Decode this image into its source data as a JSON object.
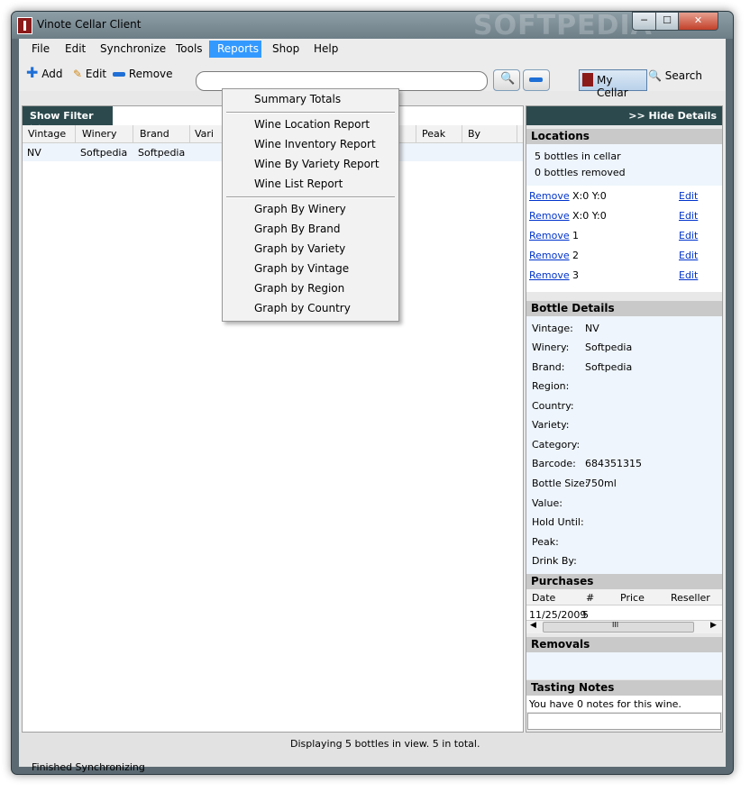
{
  "window": {
    "title": "Vinote Cellar Client",
    "watermark": "SOFTPEDIA"
  },
  "menu": {
    "file": "File",
    "edit": "Edit",
    "synchronize": "Synchronize",
    "tools": "Tools",
    "reports": "Reports",
    "shop": "Shop",
    "help": "Help"
  },
  "reports_menu": {
    "items": [
      "Summary Totals",
      "Wine Location Report",
      "Wine Inventory Report",
      "Wine By Variety Report",
      "Wine List Report",
      "Graph By Winery",
      "Graph By Brand",
      "Graph by Variety",
      "Graph by Vintage",
      "Graph by Region",
      "Graph by Country"
    ]
  },
  "toolbar": {
    "add": "Add",
    "edit": "Edit",
    "remove": "Remove",
    "my_cellar": "My Cellar",
    "search": "Search",
    "search_value": ""
  },
  "list": {
    "show_filter": "Show Filter >>",
    "columns": [
      "Vintage",
      "Winery",
      "Brand",
      "Vari",
      "old",
      "Peak",
      "By"
    ],
    "rows": [
      {
        "vintage": "NV",
        "winery": "Softpedia",
        "brand": "Softpedia"
      }
    ]
  },
  "details": {
    "hide_details": ">> Hide Details",
    "locations_title": "Locations",
    "in_cellar": "5 bottles in cellar",
    "removed": "0 bottles removed",
    "remove_label": "Remove",
    "edit_label": "Edit",
    "location_rows": [
      "X:0 Y:0",
      "X:0 Y:0",
      "1",
      "2",
      "3"
    ],
    "bottle_title": "Bottle Details",
    "fields": [
      {
        "label": "Vintage:",
        "value": "NV"
      },
      {
        "label": "Winery:",
        "value": "Softpedia"
      },
      {
        "label": "Brand:",
        "value": "Softpedia"
      },
      {
        "label": "Region:",
        "value": ""
      },
      {
        "label": "Country:",
        "value": ""
      },
      {
        "label": "Variety:",
        "value": ""
      },
      {
        "label": "Category:",
        "value": ""
      },
      {
        "label": "Barcode:",
        "value": "684351315"
      },
      {
        "label": "Bottle Size:",
        "value": "750ml"
      },
      {
        "label": "Value:",
        "value": ""
      },
      {
        "label": "Hold Until:",
        "value": ""
      },
      {
        "label": "Peak:",
        "value": ""
      },
      {
        "label": "Drink By:",
        "value": ""
      }
    ],
    "purchases_title": "Purchases",
    "purchase_columns": [
      "Date",
      "#",
      "Price",
      "Reseller"
    ],
    "purchase_row": {
      "date": "11/25/2009",
      "qty": "5"
    },
    "scroll_grip": "III",
    "removals_title": "Removals",
    "tasting_title": "Tasting Notes",
    "tasting_text": "You have 0 notes for this wine."
  },
  "status": {
    "display": "Displaying 5 bottles in view. 5 in total.",
    "sync": "Finished Synchronizing"
  }
}
